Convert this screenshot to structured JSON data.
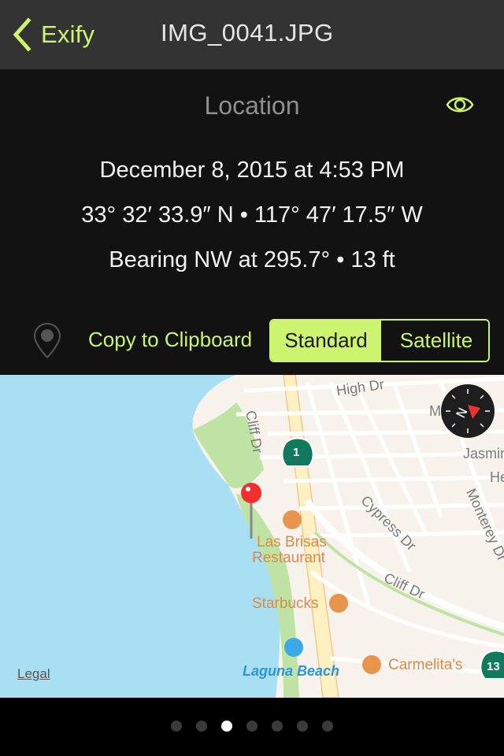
{
  "navbar": {
    "back_label": "Exify",
    "title": "IMG_0041.JPG"
  },
  "location": {
    "section_title": "Location",
    "datetime": "December 8, 2015 at 4:53 PM",
    "coordinates": "33° 32′ 33.9″ N • 117° 47′ 17.5″ W",
    "bearing": "Bearing NW at 295.7° • 13 ft",
    "copy_label": "Copy to Clipboard",
    "map_type": {
      "options": [
        "Standard",
        "Satellite"
      ],
      "selected": "Standard"
    }
  },
  "map": {
    "streets": [
      "High Dr",
      "Cliff Dr",
      "Myrtle St",
      "Jasmine",
      "He",
      "Cypress Dr",
      "Monterey Dr",
      "Cliff Dr"
    ],
    "pois": {
      "restaurant_1": "Las Brisas",
      "restaurant_1_line2": "Restaurant",
      "cafe": "Starbucks",
      "beach": "Laguna Beach",
      "restaurant_2": "Carmelita's"
    },
    "highway_shields": [
      "1",
      "13"
    ],
    "legal_label": "Legal",
    "compass_label": "N"
  },
  "pager": {
    "count": 7,
    "active_index": 2
  },
  "colors": {
    "accent": "#cdf46e",
    "navbar_bg": "#333333",
    "panel_bg": "#121212",
    "water": "#a9dff3",
    "poi": "#d98a4a",
    "beach_poi": "#3aa9e8",
    "pin": "#f0302c"
  }
}
